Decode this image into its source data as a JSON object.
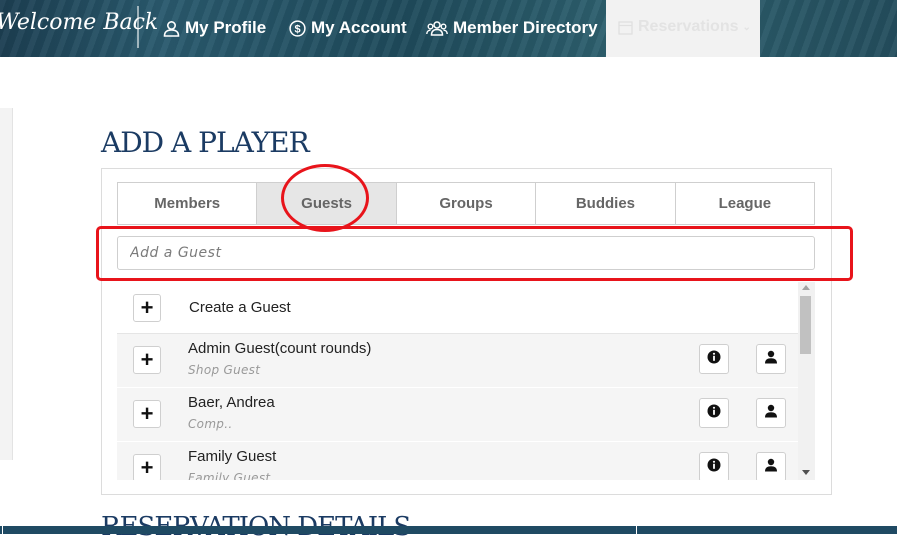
{
  "nav": {
    "welcome": "Welcome Back",
    "links": [
      {
        "label": "My Profile",
        "icon": "person-outline-icon"
      },
      {
        "label": "My Account",
        "icon": "dollar-circle-icon"
      },
      {
        "label": "Member Directory",
        "icon": "people-group-icon"
      }
    ],
    "reservations": {
      "label": "Reservations",
      "icon": "calendar-icon"
    }
  },
  "page": {
    "title": "ADD A PLAYER",
    "next_section": "RESERVATION DETAILS"
  },
  "tabs": [
    {
      "label": "Members",
      "active": false
    },
    {
      "label": "Guests",
      "active": true
    },
    {
      "label": "Groups",
      "active": false
    },
    {
      "label": "Buddies",
      "active": false
    },
    {
      "label": "League",
      "active": false
    }
  ],
  "search": {
    "placeholder": "Add a Guest"
  },
  "list": {
    "create_label": "Create a Guest",
    "guests": [
      {
        "name": "Admin Guest(count rounds)",
        "type": "Shop Guest"
      },
      {
        "name": "Baer, Andrea",
        "type": "Comp.."
      },
      {
        "name": "Family Guest",
        "type": "Family Guest"
      }
    ]
  },
  "colors": {
    "accent_navy": "#1b3b63",
    "annotation_red": "#e8141b",
    "active_tab_bg": "#e6e6e6"
  }
}
